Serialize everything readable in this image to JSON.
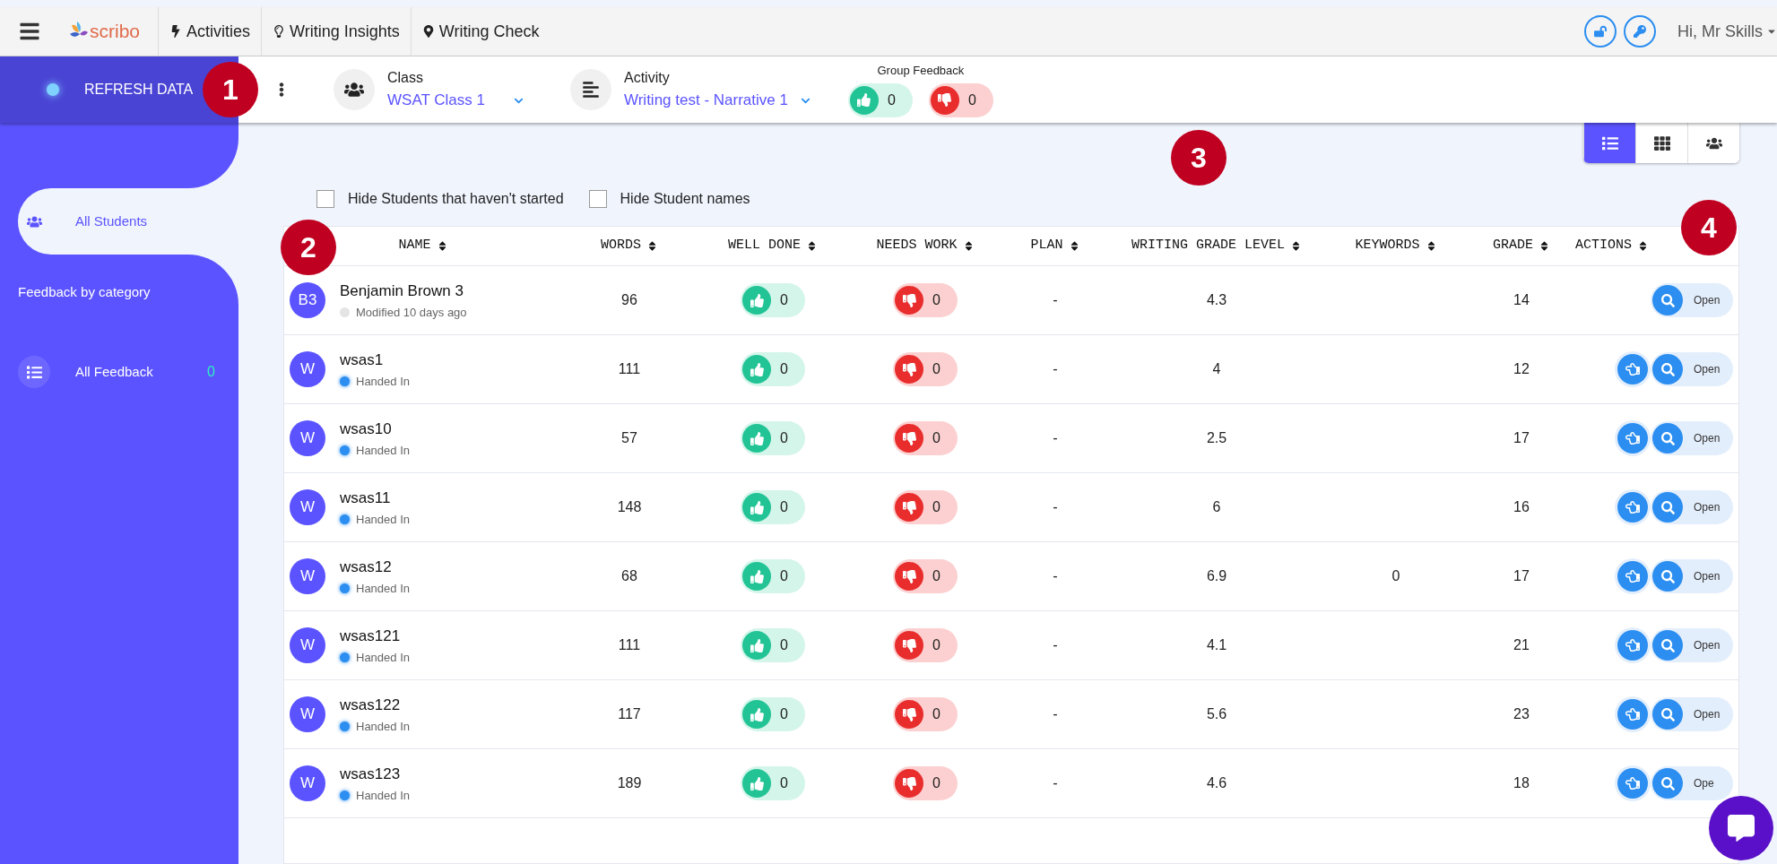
{
  "topbar": {
    "logo": "scribo",
    "nav": [
      {
        "kind": "bolt",
        "label": "Activities"
      },
      {
        "kind": "bulb",
        "label": "Writing Insights"
      },
      {
        "kind": "pin",
        "label": "Writing Check"
      }
    ],
    "greeting": "Hi, Mr Skills"
  },
  "header": {
    "refresh": "REFRESH DATA",
    "class": {
      "label": "Class",
      "value": "WSAT Class 1"
    },
    "activity": {
      "label": "Activity",
      "value": "Writing test - Narrative 1"
    },
    "group_feedback": {
      "label": "Group Feedback",
      "well_done": "0",
      "needs_work": "0"
    }
  },
  "sidebar": {
    "items": [
      {
        "kind": "students",
        "label": "All Students",
        "selected": true
      },
      {
        "kind": "heading",
        "label": "Feedback by category",
        "selected": false
      },
      {
        "kind": "list",
        "label": "All Feedback",
        "count": "0",
        "selected": false
      }
    ]
  },
  "view_buttons": [
    {
      "kind": "list",
      "selected": true
    },
    {
      "kind": "grid",
      "selected": false
    },
    {
      "kind": "group",
      "selected": false
    }
  ],
  "filters": [
    {
      "label": "Hide Students that haven't started",
      "checked": false
    },
    {
      "label": "Hide Student names",
      "checked": false
    }
  ],
  "table": {
    "columns": [
      "NAME",
      "WORDS",
      "WELL DONE",
      "NEEDS WORK",
      "PLAN",
      "WRITING GRADE LEVEL",
      "KEYWORDS",
      "GRADE",
      "ACTIONS"
    ],
    "rows": [
      {
        "initials": "B3",
        "name": "Benjamin Brown 3",
        "handed_in": false,
        "status": "Modified 10 days ago",
        "words": "96",
        "well_done": "0",
        "needs_work": "0",
        "plan": "-",
        "grade_level": "4.3",
        "keywords": "",
        "grade": "14",
        "nudge": false,
        "open": "Open"
      },
      {
        "initials": "W",
        "name": "wsas1",
        "handed_in": true,
        "status": "Handed In",
        "words": "111",
        "well_done": "0",
        "needs_work": "0",
        "plan": "-",
        "grade_level": "4",
        "keywords": "",
        "grade": "12",
        "nudge": true,
        "open": "Open"
      },
      {
        "initials": "W",
        "name": "wsas10",
        "handed_in": true,
        "status": "Handed In",
        "words": "57",
        "well_done": "0",
        "needs_work": "0",
        "plan": "-",
        "grade_level": "2.5",
        "keywords": "",
        "grade": "17",
        "nudge": true,
        "open": "Open"
      },
      {
        "initials": "W",
        "name": "wsas11",
        "handed_in": true,
        "status": "Handed In",
        "words": "148",
        "well_done": "0",
        "needs_work": "0",
        "plan": "-",
        "grade_level": "6",
        "keywords": "",
        "grade": "16",
        "nudge": true,
        "open": "Open"
      },
      {
        "initials": "W",
        "name": "wsas12",
        "handed_in": true,
        "status": "Handed In",
        "words": "68",
        "well_done": "0",
        "needs_work": "0",
        "plan": "-",
        "grade_level": "6.9",
        "keywords": "0",
        "grade": "17",
        "nudge": true,
        "open": "Open"
      },
      {
        "initials": "W",
        "name": "wsas121",
        "handed_in": true,
        "status": "Handed In",
        "words": "111",
        "well_done": "0",
        "needs_work": "0",
        "plan": "-",
        "grade_level": "4.1",
        "keywords": "",
        "grade": "21",
        "nudge": true,
        "open": "Open"
      },
      {
        "initials": "W",
        "name": "wsas122",
        "handed_in": true,
        "status": "Handed In",
        "words": "117",
        "well_done": "0",
        "needs_work": "0",
        "plan": "-",
        "grade_level": "5.6",
        "keywords": "",
        "grade": "23",
        "nudge": true,
        "open": "Open"
      },
      {
        "initials": "W",
        "name": "wsas123",
        "handed_in": true,
        "status": "Handed In",
        "words": "189",
        "well_done": "0",
        "needs_work": "0",
        "plan": "-",
        "grade_level": "4.6",
        "keywords": "",
        "grade": "18",
        "nudge": true,
        "open": "Ope"
      }
    ]
  },
  "callouts": [
    "1",
    "2",
    "3",
    "4"
  ]
}
